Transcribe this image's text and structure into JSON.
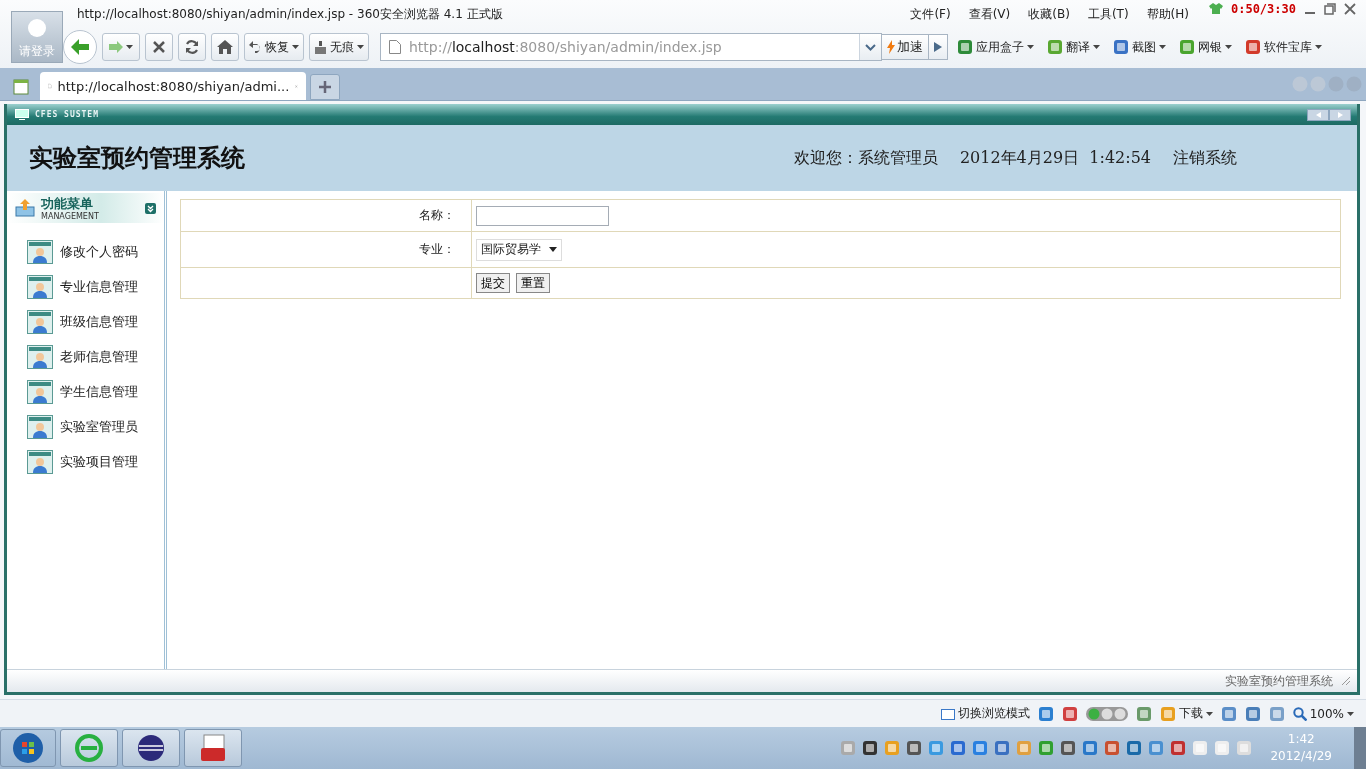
{
  "browser": {
    "avatar_label": "请登录",
    "title": "http://localhost:8080/shiyan/admin/index.jsp - 360安全浏览器 4.1 正式版",
    "menu": [
      "文件(F)",
      "查看(V)",
      "收藏(B)",
      "工具(T)",
      "帮助(H)"
    ],
    "recorder_time": "0:50/3:30",
    "restore": "恢复",
    "incognito": "无痕",
    "address": {
      "scheme": "http://",
      "host": "localhost",
      "rest": ":8080/shiyan/admin/index.jsp"
    },
    "accelerate": "加速",
    "tools": [
      {
        "label": "应用盒子",
        "kind": "box"
      },
      {
        "label": "翻译",
        "kind": "translate"
      },
      {
        "label": "截图",
        "kind": "screenshot"
      },
      {
        "label": "网银",
        "kind": "bank"
      },
      {
        "label": "软件宝库",
        "kind": "store"
      }
    ],
    "tabs": [
      {
        "title": "http://localhost:8080/shiyan/admi...",
        "selected": true
      }
    ]
  },
  "app": {
    "brand": "CFES SUSTEM",
    "title": "实验室预约管理系统",
    "welcome": "欢迎您：系统管理员",
    "date": "2012年4月29日",
    "time": "1:42:54",
    "logout": "注销系统",
    "menu": {
      "title": "功能菜单",
      "subtitle": "MANAGEMENT",
      "items": [
        {
          "label": "修改个人密码"
        },
        {
          "label": "专业信息管理"
        },
        {
          "label": "班级信息管理"
        },
        {
          "label": "老师信息管理"
        },
        {
          "label": "学生信息管理"
        },
        {
          "label": "实验室管理员"
        },
        {
          "label": "实验项目管理"
        }
      ]
    },
    "form": {
      "name_label": "名称：",
      "major_label": "专业：",
      "major_value": "国际贸易学",
      "buttons": [
        "提交",
        "重置"
      ]
    },
    "footer": "实验室预约管理系统"
  },
  "status_bar": {
    "mode": "切换浏览模式",
    "download": "下载",
    "zoom": "100%"
  },
  "taskbar": {
    "time": "1:42",
    "date": "2012/4/29"
  }
}
